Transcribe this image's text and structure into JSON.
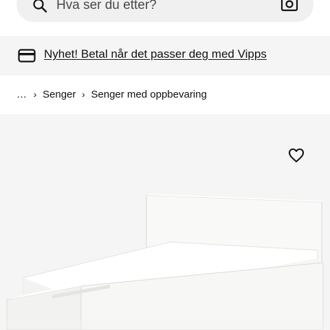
{
  "search": {
    "placeholder": "Hva ser du etter?"
  },
  "promo": {
    "text": "Nyhet! Betal når det passer deg med Vipps"
  },
  "breadcrumb": {
    "items": [
      "…",
      "Senger",
      "Senger med oppbevaring"
    ]
  },
  "product": {
    "image_subject": "bed-with-storage-white"
  },
  "icons": {
    "search": "search-icon",
    "camera": "camera-icon",
    "card": "credit-card-icon",
    "chevron": "chevron-right-icon",
    "heart": "heart-icon"
  },
  "colors": {
    "page_background": "#ffffff",
    "search_background": "#f0f0f0",
    "promo_background": "#f5f5f5",
    "image_background": "#f5f5f5",
    "text": "#111111"
  }
}
